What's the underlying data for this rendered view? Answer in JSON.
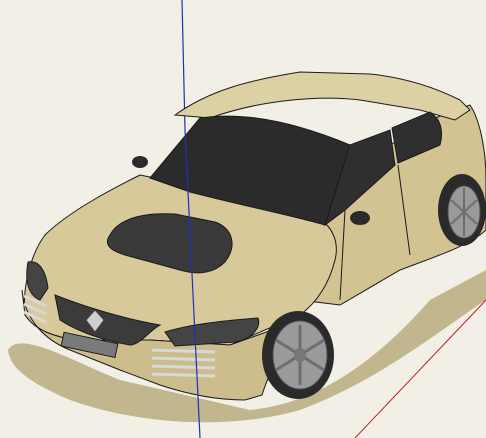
{
  "viewport": {
    "background_color": "#f2efe7"
  },
  "colors": {
    "car_body": "#d8c99a",
    "car_body_light": "#e8dcb3",
    "car_body_shadow": "#bfae7e",
    "glass": "#2b2b2b",
    "outline": "#1a1a1a",
    "shadow": "#b8ab7d",
    "axis_blue": "#1f2fbf",
    "axis_red": "#c81e1e",
    "rim": "#9a9a9a",
    "tire": "#2a2a2a",
    "chrome": "#d9d9d9"
  },
  "scene": {
    "object": "car-model",
    "axes": [
      "blue-vertical-axis",
      "red-horizontal-axis"
    ]
  }
}
